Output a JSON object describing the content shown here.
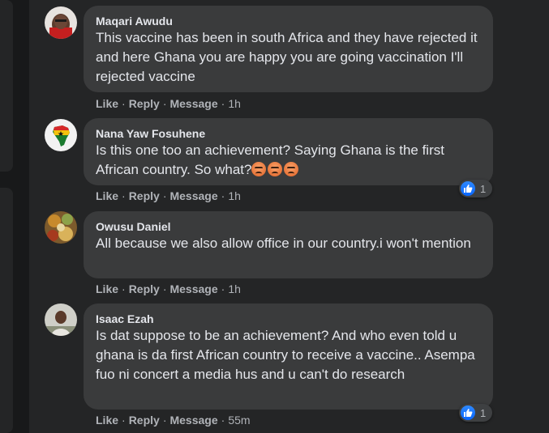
{
  "comments": [
    {
      "author": "Maqari Awudu",
      "text": "This vaccine has been in south Africa and they have rejected it and here Ghana you are happy you are going vaccination I'll rejected vaccine",
      "actions": {
        "like": "Like",
        "reply": "Reply",
        "message": "Message"
      },
      "time": "1h"
    },
    {
      "author": "Nana Yaw Fosuhene",
      "text": "Is this one too an achievement? Saying Ghana is the first African country. So what?",
      "emojis": [
        "angry-face-icon",
        "angry-face-icon",
        "angry-face-icon"
      ],
      "actions": {
        "like": "Like",
        "reply": "Reply",
        "message": "Message"
      },
      "time": "1h",
      "reaction_count": "1"
    },
    {
      "author": "Owusu Daniel",
      "text": "All because we also allow office in our country.i won't mention",
      "actions": {
        "like": "Like",
        "reply": "Reply",
        "message": "Message"
      },
      "time": "1h"
    },
    {
      "author": "Isaac Ezah",
      "text": "Is dat suppose to be an achievement? And who even told u ghana is da first African country to receive a vaccine.. Asempa fuo ni concert a media hus and u can't do research",
      "actions": {
        "like": "Like",
        "reply": "Reply",
        "message": "Message"
      },
      "time": "55m",
      "reaction_count": "1"
    }
  ],
  "separator": "·",
  "colors": {
    "background": "#18191a",
    "panel": "#242526",
    "bubble": "#3a3b3c",
    "text": "#e4e6eb",
    "secondary_text": "#b0b3b8",
    "like_blue": "#0866ff"
  }
}
